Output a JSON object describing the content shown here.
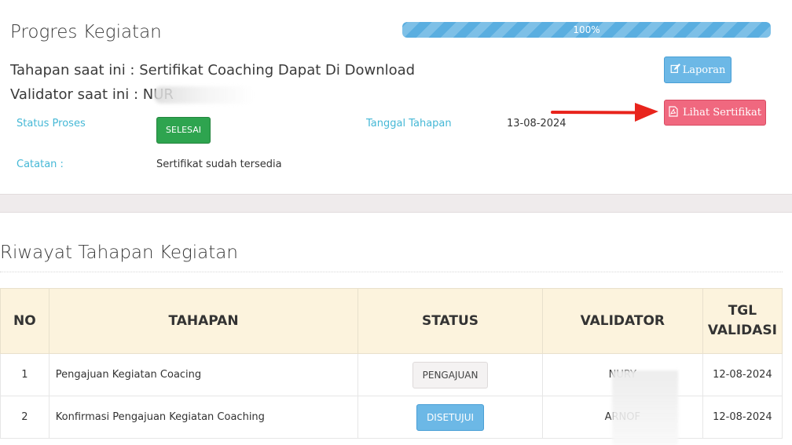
{
  "progress": {
    "title": "Progres Kegiatan",
    "percent_value": 1.0,
    "percent_label": "100%",
    "stage_text": "Tahapan saat ini : Sertifikat Coaching Dapat Di Download",
    "validator_text": "Validator saat ini : NUR",
    "status_label": "Status Proses",
    "status_value": "SELESAI",
    "date_label": "Tanggal Tahapan",
    "date_value": "13-08-2024",
    "note_label": "Catatan :",
    "note_value": "Sertifikat sudah tersedia",
    "laporan_button_label": "Laporan",
    "lihat_button_label": "Lihat Sertifikat"
  },
  "history": {
    "title": "Riwayat Tahapan Kegiatan",
    "columns": [
      "NO",
      "TAHAPAN",
      "STATUS",
      "VALIDATOR",
      "TGL VALIDASI"
    ],
    "rows": [
      {
        "no": "1",
        "stage": "Pengajuan Kegiatan Coacing",
        "status": "PENGAJUAN",
        "validator": "NURY",
        "date": "12-08-2024"
      },
      {
        "no": "2",
        "stage": "Konfirmasi Pengajuan Kegiatan Coaching",
        "status": "DISETUJUI",
        "validator": "ARNOF",
        "date": "12-08-2024"
      }
    ]
  },
  "icons": {
    "laporan_icon": "edit-icon",
    "lihat_icon": "pdf-file-icon",
    "annotation": "red-arrow"
  },
  "colors": {
    "progress": "#5aaee0",
    "success": "#2ea44f",
    "info": "#6cb8e6",
    "danger": "#f0687f",
    "label": "#45b8d6",
    "table_header": "#fcf3dd"
  }
}
